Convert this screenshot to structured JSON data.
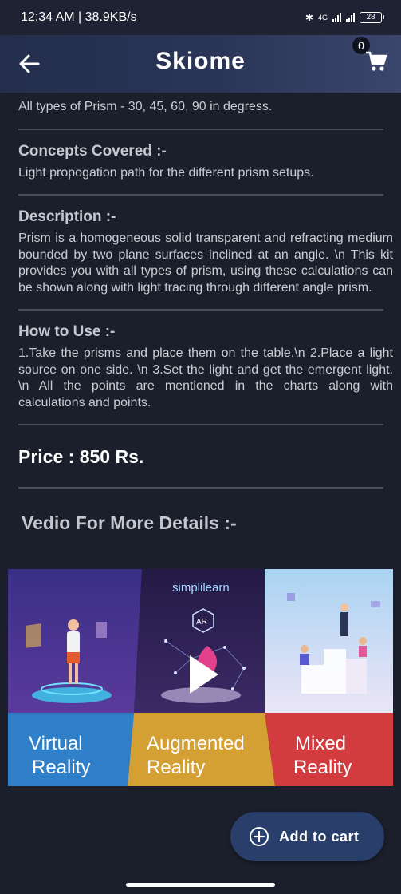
{
  "status_bar": {
    "time_speed": "12:34 AM | 38.9KB/s",
    "network_label": "4G",
    "battery": "28"
  },
  "app_bar": {
    "title": "Skiome",
    "cart_count": "0"
  },
  "product": {
    "intro_text": "All types of Prism - 30, 45, 60, 90 in degress.",
    "concepts_heading": "Concepts Covered :-",
    "concepts_text": "Light propogation path for the different prism setups.",
    "description_heading": "Description :-",
    "description_text": "Prism is a homogeneous solid transparent and refracting medium bounded by two plane surfaces inclined at an angle. \\n This kit provides  you with all types of prism, using these calculations can be shown along with light tracing through different angle prism.",
    "how_to_heading": "How to Use :-",
    "how_to_text": "1.Take the prisms and place them on the table.\\n 2.Place a light source on one side. \\n 3.Set the light and get the emergent light. \\n All the points are mentioned in the charts along with calculations and points.",
    "price_label": "Price : 850 Rs.",
    "video_heading": "Vedio For More Details :-"
  },
  "video_banner": {
    "brand": "simplilearn",
    "ar_badge": "AR",
    "panels": [
      {
        "line1": "Virtual",
        "line2": "Reality",
        "color": "#2f7fc9"
      },
      {
        "line1": "Augmented",
        "line2": "Reality",
        "color": "#d4a033"
      },
      {
        "line1": "Mixed",
        "line2": "Reality",
        "color": "#d23c3f"
      }
    ]
  },
  "add_to_cart": {
    "label": "Add to cart"
  },
  "colors": {
    "background": "#1b1f2b",
    "app_bar": "#2a3558",
    "button": "#2a3e6b"
  }
}
